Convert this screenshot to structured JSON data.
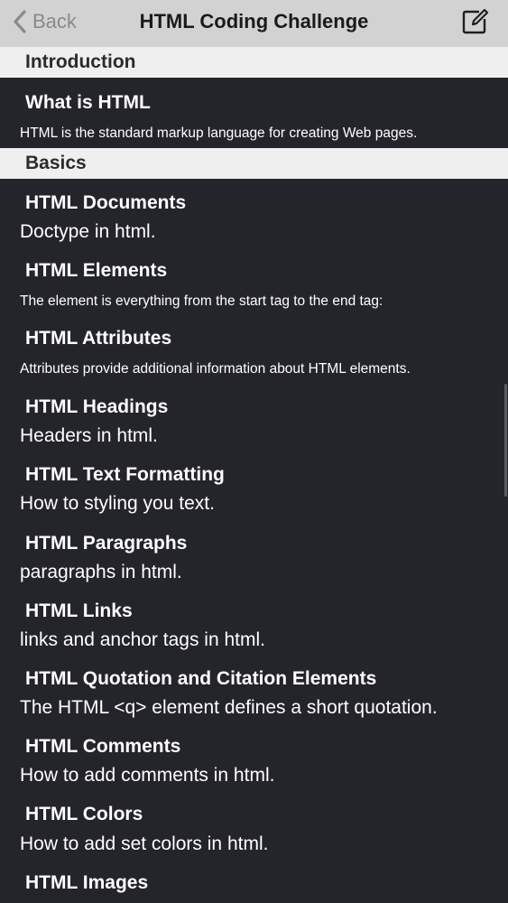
{
  "nav": {
    "back_label": "Back",
    "title": "HTML Coding Challenge",
    "back_icon": "chevron-left-icon",
    "compose_icon": "compose-icon"
  },
  "sections": [
    {
      "title": "Introduction",
      "items": [
        {
          "title": "What is HTML",
          "subtitle": "HTML is the standard markup language for creating Web pages."
        }
      ]
    },
    {
      "title": "Basics",
      "items": [
        {
          "title": "HTML Documents",
          "subtitle": "Doctype in html."
        },
        {
          "title": "HTML Elements",
          "subtitle": "The element is everything from the start tag to the end tag:"
        },
        {
          "title": "HTML Attributes",
          "subtitle": "Attributes provide additional information about HTML elements."
        },
        {
          "title": "HTML Headings",
          "subtitle": "Headers in html."
        },
        {
          "title": "HTML Text Formatting",
          "subtitle": "How to styling you text."
        },
        {
          "title": "HTML Paragraphs",
          "subtitle": "paragraphs in html."
        },
        {
          "title": "HTML Links",
          "subtitle": "links and anchor tags in html."
        },
        {
          "title": "HTML Quotation and Citation Elements",
          "subtitle": "The HTML <q> element defines a short quotation."
        },
        {
          "title": "HTML Comments",
          "subtitle": "How to add comments in html."
        },
        {
          "title": "HTML Colors",
          "subtitle": "How to add set colors in html."
        },
        {
          "title": "HTML Images",
          "subtitle": ""
        }
      ]
    }
  ],
  "colors": {
    "navbar_bg": "#d2d2d2",
    "list_bg": "#24242b",
    "section_bg": "#efefef",
    "text_primary": "#ffffff"
  }
}
